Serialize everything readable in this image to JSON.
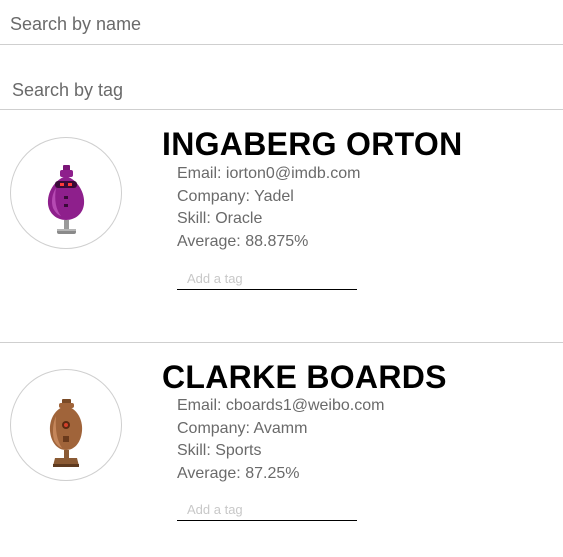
{
  "search": {
    "name_placeholder": "Search by name",
    "tag_placeholder": "Search by tag"
  },
  "students": [
    {
      "name": "INGABERG ORTON",
      "email": "Email: iorton0@imdb.com",
      "company": "Company: Yadel",
      "skill": "Skill: Oracle",
      "average": "Average: 88.875%",
      "tag_placeholder": "Add a tag",
      "avatar_icon": "purple-robot-avatar-icon",
      "avatar_color": "#8e1f8c"
    },
    {
      "name": "CLARKE BOARDS",
      "email": "Email: cboards1@weibo.com",
      "company": "Company: Avamm",
      "skill": "Skill: Sports",
      "average": "Average: 87.25%",
      "tag_placeholder": "Add a tag",
      "avatar_icon": "brown-robot-avatar-icon",
      "avatar_color": "#a0643a"
    }
  ],
  "colors": {
    "divider": "#cfcfcf",
    "detail_text": "#6a6a6a",
    "tag_placeholder": "#c8c8c8"
  }
}
